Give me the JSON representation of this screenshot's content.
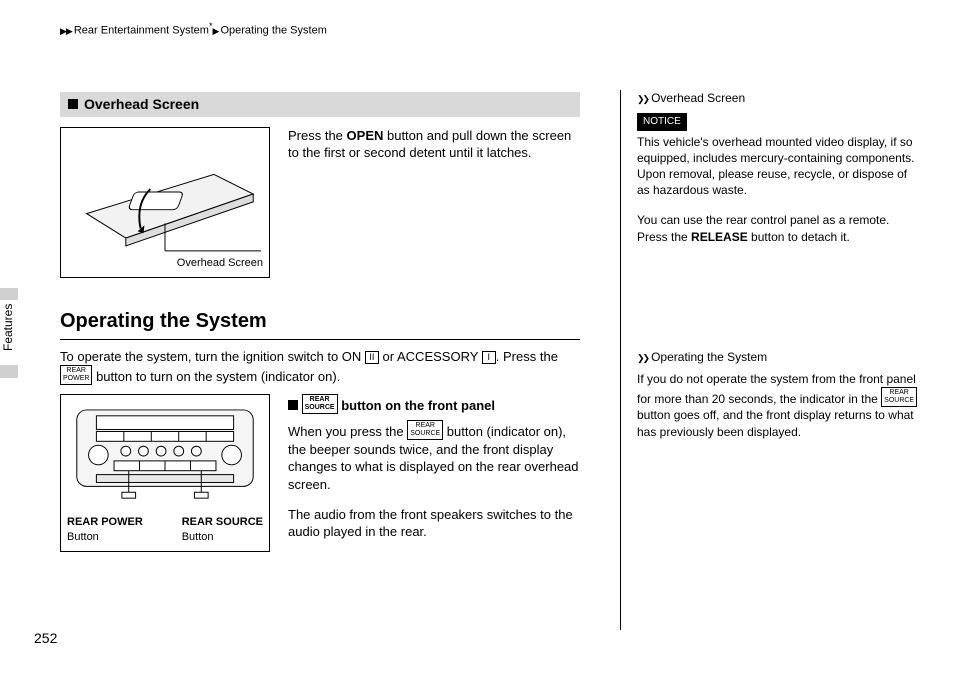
{
  "breadcrumb": {
    "part1": "Rear Entertainment System",
    "sup": "*",
    "part2": "Operating the System"
  },
  "features_tab": "Features",
  "section1": {
    "heading": "Overhead Screen",
    "fig_caption": "Overhead Screen",
    "para_pre": "Press the ",
    "open": "OPEN",
    "para_post": " button and pull down the screen to the first or second detent until it latches."
  },
  "section2": {
    "title": "Operating the System",
    "intro1": "To operate the system, turn the ignition switch to ON ",
    "key_ii": "II",
    "intro2": " or ACCESSORY ",
    "key_i": "I",
    "intro3": ". Press the ",
    "rear_power_t": "REAR",
    "rear_power_b": "POWER",
    "intro4": " button to turn on the system (indicator on).",
    "sub_head_pre": " ",
    "rear_source_t": "REAR",
    "rear_source_b": "SOURCE",
    "sub_head_post": " button on the front panel",
    "p2a": "When you press the ",
    "p2b": " button (indicator on), the beeper sounds twice, and the front display changes to what is displayed on the rear overhead screen.",
    "p3": "The audio from the front speakers switches to the audio played in the rear.",
    "fig_labels": {
      "l_bold": "REAR POWER",
      "l_sub": "Button",
      "r_bold": "REAR SOURCE",
      "r_sub": "Button"
    }
  },
  "sidebar": {
    "h1": "Overhead Screen",
    "notice": "NOTICE",
    "n1": "This vehicle's overhead mounted video display, if so equipped, includes mercury-containing components. Upon removal, please reuse, recycle, or dispose of as hazardous waste.",
    "n2a": "You can use the rear control panel as a remote. Press the ",
    "release": "RELEASE",
    "n2b": " button to detach it.",
    "h2": "Operating the System",
    "o1a": "If you do not operate the system from the front panel for more than 20 seconds, the indicator in the ",
    "o1b": " button goes off, and the front display returns to what has previously been displayed."
  },
  "page_number": "252"
}
